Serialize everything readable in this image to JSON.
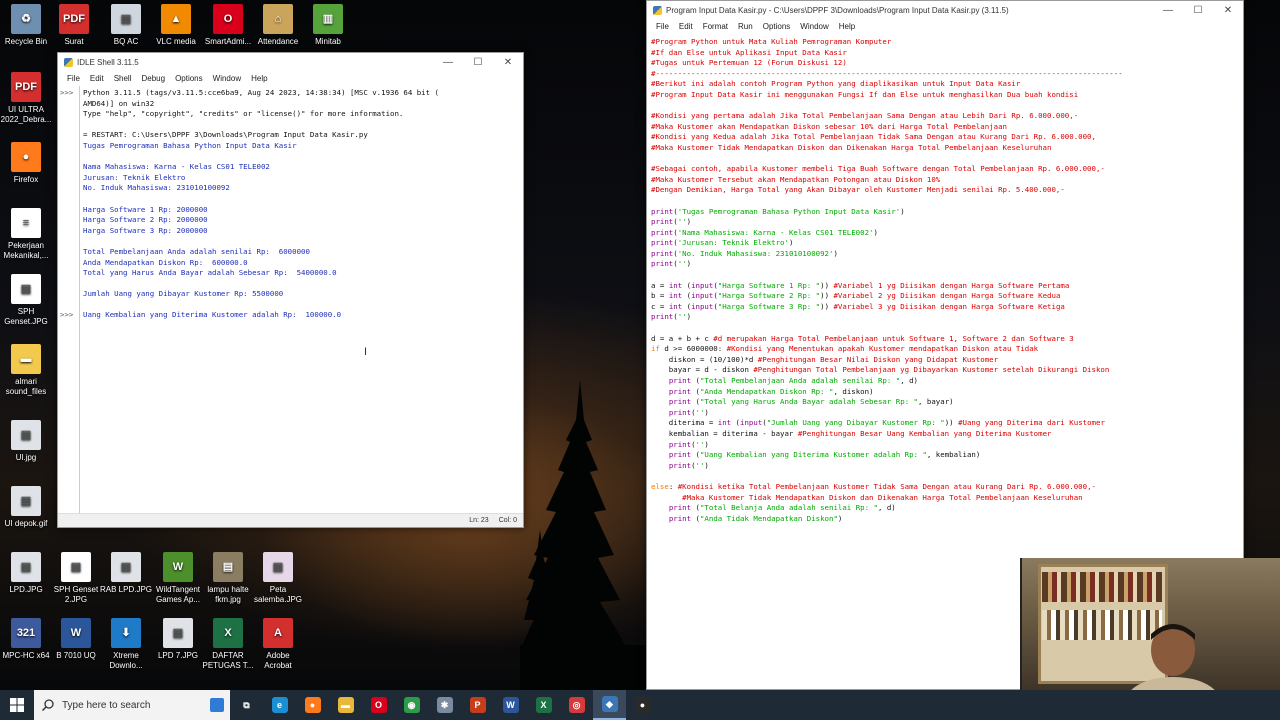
{
  "desktop": {
    "icons": [
      {
        "label": "Recycle Bin",
        "icon": "recycle-bin-icon",
        "color": "#6f8fb0",
        "glyph": "♻"
      },
      {
        "label": "Surat",
        "icon": "pdf-icon",
        "color": "#d32f2f",
        "glyph": "PDF"
      },
      {
        "label": "BQ AC",
        "icon": "image-file-icon",
        "color": "#cfd6dd",
        "glyph": "▤"
      },
      {
        "label": "VLC media",
        "icon": "vlc-icon",
        "color": "#f08a00",
        "glyph": "▲"
      },
      {
        "label": "SmartAdmi...",
        "icon": "opera-icon",
        "color": "#d9001b",
        "glyph": "O"
      },
      {
        "label": "Attendance",
        "icon": "attendance-app-icon",
        "color": "#c9a45a",
        "glyph": "⌂"
      },
      {
        "label": "Minitab",
        "icon": "minitab-icon",
        "color": "#56a33c",
        "glyph": "▥"
      },
      {
        "label": "UI ULTRA 2022_Debra...",
        "icon": "pdf-icon",
        "color": "#d32f2f",
        "glyph": "PDF"
      },
      {
        "label": "Firefox",
        "icon": "firefox-icon",
        "color": "#ff7a1a",
        "glyph": "●"
      },
      {
        "label": "Pekerjaan Mekanikal,...",
        "icon": "document-icon",
        "color": "#ffffff",
        "glyph": "≡"
      },
      {
        "label": "SPH Genset.JPG",
        "icon": "image-file-icon",
        "color": "#ffffff",
        "glyph": "▤"
      },
      {
        "label": "almari sound_files",
        "icon": "folder-icon",
        "color": "#f2c94c",
        "glyph": "▬"
      },
      {
        "label": "Ul.jpg",
        "icon": "image-file-icon",
        "color": "#dfe3e8",
        "glyph": "▤"
      },
      {
        "label": "UI depok.gif",
        "icon": "image-file-icon",
        "color": "#dfe3e8",
        "glyph": "▤"
      },
      {
        "label": "LPD.JPG",
        "icon": "image-file-icon",
        "color": "#dfe3e8",
        "glyph": "▤"
      },
      {
        "label": "SPH Genset 2.JPG",
        "icon": "image-file-icon",
        "color": "#ffffff",
        "glyph": "▤"
      },
      {
        "label": "RAB LPD.JPG",
        "icon": "image-file-icon",
        "color": "#dfe3e8",
        "glyph": "▤"
      },
      {
        "label": "WildTangent Games Ap...",
        "icon": "wildtangent-icon",
        "color": "#4d8f2a",
        "glyph": "W"
      },
      {
        "label": "lampu halte fkm.jpg",
        "icon": "image-file-icon",
        "color": "#8a7d62",
        "glyph": "▤"
      },
      {
        "label": "Peta salemba.JPG",
        "icon": "image-file-icon",
        "color": "#e6d7e9",
        "glyph": "▤"
      },
      {
        "label": "MPC-HC x64",
        "icon": "mpc-hc-icon",
        "color": "#3d5a9c",
        "glyph": "321"
      },
      {
        "label": "B 7010 UQ",
        "icon": "word-icon",
        "color": "#2b579a",
        "glyph": "W"
      },
      {
        "label": "Xtreme Downlo...",
        "icon": "xtreme-download-icon",
        "color": "#1f7ac8",
        "glyph": "⬇"
      },
      {
        "label": "LPD 7.JPG",
        "icon": "image-file-icon",
        "color": "#dfe3e8",
        "glyph": "▤"
      },
      {
        "label": "DAFTAR PETUGAS T...",
        "icon": "excel-icon",
        "color": "#1e7145",
        "glyph": "X"
      },
      {
        "label": "Adobe Acrobat",
        "icon": "acrobat-icon",
        "color": "#d32f2f",
        "glyph": "A"
      }
    ]
  },
  "shell": {
    "title": "IDLE Shell 3.11.5",
    "menu": [
      "File",
      "Edit",
      "Shell",
      "Debug",
      "Options",
      "Window",
      "Help"
    ],
    "gutter": [
      ">>>",
      "",
      "",
      "",
      "",
      "",
      "",
      "",
      "",
      "",
      "",
      "",
      "",
      "",
      "",
      "",
      "",
      "",
      "",
      "",
      "",
      ">>>"
    ],
    "lines": [
      {
        "text": "Python 3.11.5 (tags/v3.11.5:cce6ba9, Aug 24 2023, 14:38:34) [MSC v.1936 64 bit (",
        "cls": "c-black"
      },
      {
        "text": "AMD64)] on win32",
        "cls": "c-black"
      },
      {
        "text": "Type \"help\", \"copyright\", \"credits\" or \"license()\" for more information.",
        "cls": "c-black"
      },
      {
        "text": "",
        "cls": "c-black"
      },
      {
        "text": "= RESTART: C:\\Users\\DPPF 3\\Downloads\\Program Input Data Kasir.py",
        "cls": "c-black"
      },
      {
        "text": "Tugas Pemrograman Bahasa Python Input Data Kasir",
        "cls": "c-blue"
      },
      {
        "text": "",
        "cls": "c-blue"
      },
      {
        "text": "Nama Mahasiswa: Karna - Kelas CS01 TELE002",
        "cls": "c-blue"
      },
      {
        "text": "Jurusan: Teknik Elektro",
        "cls": "c-blue"
      },
      {
        "text": "No. Induk Mahasiswa: 231010100092",
        "cls": "c-blue"
      },
      {
        "text": "",
        "cls": "c-blue"
      },
      {
        "text": "Harga Software 1 Rp: 2000000",
        "cls": "c-blue"
      },
      {
        "text": "Harga Software 2 Rp: 2000000",
        "cls": "c-blue"
      },
      {
        "text": "Harga Software 3 Rp: 2000000",
        "cls": "c-blue"
      },
      {
        "text": "",
        "cls": "c-blue"
      },
      {
        "text": "Total Pembelanjaan Anda adalah senilai Rp:  6000000",
        "cls": "c-blue"
      },
      {
        "text": "Anda Mendapatkan Diskon Rp:  600000.0",
        "cls": "c-blue"
      },
      {
        "text": "Total yang Harus Anda Bayar adalah Sebesar Rp:  5400000.0",
        "cls": "c-blue"
      },
      {
        "text": "",
        "cls": "c-blue"
      },
      {
        "text": "Jumlah Uang yang Dibayar Kustomer Rp: 5500000",
        "cls": "c-blue"
      },
      {
        "text": "",
        "cls": "c-blue"
      },
      {
        "text": "Uang Kembalian yang Diterima Kustomer adalah Rp:  100000.0",
        "cls": "c-blue"
      }
    ],
    "status": {
      "line": "Ln: 23",
      "col": "Col: 0"
    }
  },
  "editor": {
    "title": "Program Input Data Kasir.py - C:\\Users\\DPPF 3\\Downloads\\Program Input Data Kasir.py (3.11.5)",
    "menu": [
      "File",
      "Edit",
      "Format",
      "Run",
      "Options",
      "Window",
      "Help"
    ],
    "lines": [
      [
        {
          "t": "#Program Python untuk Mata Kuliah Pemrograman Komputer",
          "c": "cm"
        }
      ],
      [
        {
          "t": "#If dan Else untuk Aplikasi Input Data Kasir",
          "c": "cm"
        }
      ],
      [
        {
          "t": "#Tugas untuk Pertemuan 12 (Forum Diskusi 12)",
          "c": "cm"
        }
      ],
      [
        {
          "t": "#---------------------------------------------------------------------------------------------------------",
          "c": "cm"
        }
      ],
      [
        {
          "t": "#Berikut ini adalah contoh Program Python yang diaplikasikan untuk Input Data Kasir",
          "c": "cm"
        }
      ],
      [
        {
          "t": "#Program Input Data Kasir ini menggunakan Fungsi If dan Else untuk menghasilkan Dua buah kondisi",
          "c": "cm"
        }
      ],
      [
        {
          "t": "",
          "c": "tx"
        }
      ],
      [
        {
          "t": "#Kondisi yang pertama adalah Jika Total Pembelanjaan Sama Dengan atau Lebih Dari Rp. 6.000.000,-",
          "c": "cm"
        }
      ],
      [
        {
          "t": "#Maka Kustomer akan Mendapatkan Diskon sebesar 10% dari Harga Total Pembelanjaan",
          "c": "cm"
        }
      ],
      [
        {
          "t": "#Kondisi yang Kedua adalah Jika Total Pembelanjaan Tidak Sama Dengan atau Kurang Dari Rp. 6.000.000,",
          "c": "cm"
        }
      ],
      [
        {
          "t": "#Maka Kustomer Tidak Mendapatkan Diskon dan Dikenakan Harga Total Pembelanjaan Keseluruhan",
          "c": "cm"
        }
      ],
      [
        {
          "t": "",
          "c": "tx"
        }
      ],
      [
        {
          "t": "#Sebagai contoh, apabila Kustomer membeli Tiga Buah Software dengan Total Pembelanjaan Rp. 6.000.000,-",
          "c": "cm"
        }
      ],
      [
        {
          "t": "#Maka Kustomer Tersebut akan Mendapatkan Potongan atau Diskon 10%",
          "c": "cm"
        }
      ],
      [
        {
          "t": "#Dengan Demikian, Harga Total yang Akan Dibayar oleh Kustomer Menjadi senilai Rp. 5.400.000,-",
          "c": "cm"
        }
      ],
      [
        {
          "t": "",
          "c": "tx"
        }
      ],
      [
        {
          "t": "print",
          "c": "bi"
        },
        {
          "t": "(",
          "c": "tx"
        },
        {
          "t": "'Tugas Pemrograman Bahasa Python Input Data Kasir'",
          "c": "st"
        },
        {
          "t": ")",
          "c": "tx"
        }
      ],
      [
        {
          "t": "print",
          "c": "bi"
        },
        {
          "t": "(",
          "c": "tx"
        },
        {
          "t": "''",
          "c": "st"
        },
        {
          "t": ")",
          "c": "tx"
        }
      ],
      [
        {
          "t": "print",
          "c": "bi"
        },
        {
          "t": "(",
          "c": "tx"
        },
        {
          "t": "'Nama Mahasiswa: Karna - Kelas CS01 TELE002'",
          "c": "st"
        },
        {
          "t": ")",
          "c": "tx"
        }
      ],
      [
        {
          "t": "print",
          "c": "bi"
        },
        {
          "t": "(",
          "c": "tx"
        },
        {
          "t": "'Jurusan: Teknik Elektro'",
          "c": "st"
        },
        {
          "t": ")",
          "c": "tx"
        }
      ],
      [
        {
          "t": "print",
          "c": "bi"
        },
        {
          "t": "(",
          "c": "tx"
        },
        {
          "t": "'No. Induk Mahasiswa: 231010100092'",
          "c": "st"
        },
        {
          "t": ")",
          "c": "tx"
        }
      ],
      [
        {
          "t": "print",
          "c": "bi"
        },
        {
          "t": "(",
          "c": "tx"
        },
        {
          "t": "''",
          "c": "st"
        },
        {
          "t": ")",
          "c": "tx"
        }
      ],
      [
        {
          "t": "",
          "c": "tx"
        }
      ],
      [
        {
          "t": "a = ",
          "c": "tx"
        },
        {
          "t": "int",
          "c": "bi"
        },
        {
          "t": " (",
          "c": "tx"
        },
        {
          "t": "input",
          "c": "bi"
        },
        {
          "t": "(",
          "c": "tx"
        },
        {
          "t": "\"Harga Software 1 Rp: \"",
          "c": "st"
        },
        {
          "t": ")) ",
          "c": "tx"
        },
        {
          "t": "#Variabel 1 yg Diisikan dengan Harga Software Pertama",
          "c": "cm"
        }
      ],
      [
        {
          "t": "b = ",
          "c": "tx"
        },
        {
          "t": "int",
          "c": "bi"
        },
        {
          "t": " (",
          "c": "tx"
        },
        {
          "t": "input",
          "c": "bi"
        },
        {
          "t": "(",
          "c": "tx"
        },
        {
          "t": "\"Harga Software 2 Rp: \"",
          "c": "st"
        },
        {
          "t": ")) ",
          "c": "tx"
        },
        {
          "t": "#Variabel 2 yg Diisikan dengan Harga Software Kedua",
          "c": "cm"
        }
      ],
      [
        {
          "t": "c = ",
          "c": "tx"
        },
        {
          "t": "int",
          "c": "bi"
        },
        {
          "t": " (",
          "c": "tx"
        },
        {
          "t": "input",
          "c": "bi"
        },
        {
          "t": "(",
          "c": "tx"
        },
        {
          "t": "\"Harga Software 3 Rp: \"",
          "c": "st"
        },
        {
          "t": ")) ",
          "c": "tx"
        },
        {
          "t": "#Variabel 3 yg Diisikan dengan Harga Software Ketiga",
          "c": "cm"
        }
      ],
      [
        {
          "t": "print",
          "c": "bi"
        },
        {
          "t": "(",
          "c": "tx"
        },
        {
          "t": "''",
          "c": "st"
        },
        {
          "t": ")",
          "c": "tx"
        }
      ],
      [
        {
          "t": "",
          "c": "tx"
        }
      ],
      [
        {
          "t": "d = a + b + c ",
          "c": "tx"
        },
        {
          "t": "#d merupakan Harga Total Pembelanjaan untuk Software 1, Software 2 dan Software 3",
          "c": "cm"
        }
      ],
      [
        {
          "t": "if",
          "c": "kw"
        },
        {
          "t": " d >= 6000000: ",
          "c": "tx"
        },
        {
          "t": "#Kondisi yang Menentukan apakah Kustomer mendapatkan Diskon atau Tidak",
          "c": "cm"
        }
      ],
      [
        {
          "t": "    diskon = (10/100)*d ",
          "c": "tx"
        },
        {
          "t": "#Penghitungan Besar Nilai Diskon yang Didapat Kustomer",
          "c": "cm"
        }
      ],
      [
        {
          "t": "    bayar = d - diskon ",
          "c": "tx"
        },
        {
          "t": "#Penghitungan Total Pembelanjaan yg Dibayarkan Kustomer setelah Dikurangi Diskon",
          "c": "cm"
        }
      ],
      [
        {
          "t": "    ",
          "c": "tx"
        },
        {
          "t": "print",
          "c": "bi"
        },
        {
          "t": " (",
          "c": "tx"
        },
        {
          "t": "\"Total Pembelanjaan Anda adalah senilai Rp: \"",
          "c": "st"
        },
        {
          "t": ", d)",
          "c": "tx"
        }
      ],
      [
        {
          "t": "    ",
          "c": "tx"
        },
        {
          "t": "print",
          "c": "bi"
        },
        {
          "t": " (",
          "c": "tx"
        },
        {
          "t": "\"Anda Mendapatkan Diskon Rp: \"",
          "c": "st"
        },
        {
          "t": ", diskon)",
          "c": "tx"
        }
      ],
      [
        {
          "t": "    ",
          "c": "tx"
        },
        {
          "t": "print",
          "c": "bi"
        },
        {
          "t": " (",
          "c": "tx"
        },
        {
          "t": "\"Total yang Harus Anda Bayar adalah Sebesar Rp: \"",
          "c": "st"
        },
        {
          "t": ", bayar)",
          "c": "tx"
        }
      ],
      [
        {
          "t": "    ",
          "c": "tx"
        },
        {
          "t": "print",
          "c": "bi"
        },
        {
          "t": "(",
          "c": "tx"
        },
        {
          "t": "''",
          "c": "st"
        },
        {
          "t": ")",
          "c": "tx"
        }
      ],
      [
        {
          "t": "    diterima = ",
          "c": "tx"
        },
        {
          "t": "int",
          "c": "bi"
        },
        {
          "t": " (",
          "c": "tx"
        },
        {
          "t": "input",
          "c": "bi"
        },
        {
          "t": "(",
          "c": "tx"
        },
        {
          "t": "\"Jumlah Uang yang Dibayar Kustomer Rp: \"",
          "c": "st"
        },
        {
          "t": ")) ",
          "c": "tx"
        },
        {
          "t": "#Uang yang Diterima dari Kustomer",
          "c": "cm"
        }
      ],
      [
        {
          "t": "    kembalian = diterima - bayar ",
          "c": "tx"
        },
        {
          "t": "#Penghitungan Besar Uang Kembalian yang Diterima Kustomer",
          "c": "cm"
        }
      ],
      [
        {
          "t": "    ",
          "c": "tx"
        },
        {
          "t": "print",
          "c": "bi"
        },
        {
          "t": "(",
          "c": "tx"
        },
        {
          "t": "''",
          "c": "st"
        },
        {
          "t": ")",
          "c": "tx"
        }
      ],
      [
        {
          "t": "    ",
          "c": "tx"
        },
        {
          "t": "print",
          "c": "bi"
        },
        {
          "t": " (",
          "c": "tx"
        },
        {
          "t": "\"Uang Kembalian yang Diterima Kustomer adalah Rp: \"",
          "c": "st"
        },
        {
          "t": ", kembalian)",
          "c": "tx"
        }
      ],
      [
        {
          "t": "    ",
          "c": "tx"
        },
        {
          "t": "print",
          "c": "bi"
        },
        {
          "t": "(",
          "c": "tx"
        },
        {
          "t": "''",
          "c": "st"
        },
        {
          "t": ")",
          "c": "tx"
        }
      ],
      [
        {
          "t": "",
          "c": "tx"
        }
      ],
      [
        {
          "t": "else",
          "c": "kw"
        },
        {
          "t": ": ",
          "c": "tx"
        },
        {
          "t": "#Kondisi ketika Total Pembelanjaan Kustomer Tidak Sama Dengan atau Kurang Dari Rp. 6.000.000,-",
          "c": "cm"
        }
      ],
      [
        {
          "t": "       ",
          "c": "tx"
        },
        {
          "t": "#Maka Kustomer Tidak Mendapatkan Diskon dan Dikenakan Harga Total Pembelanjaan Keseluruhan",
          "c": "cm"
        }
      ],
      [
        {
          "t": "    ",
          "c": "tx"
        },
        {
          "t": "print",
          "c": "bi"
        },
        {
          "t": " (",
          "c": "tx"
        },
        {
          "t": "\"Total Belanja Anda adalah senilai Rp: \"",
          "c": "st"
        },
        {
          "t": ", d)",
          "c": "tx"
        }
      ],
      [
        {
          "t": "    ",
          "c": "tx"
        },
        {
          "t": "print",
          "c": "bi"
        },
        {
          "t": " (",
          "c": "tx"
        },
        {
          "t": "\"Anda Tidak Mendapatkan Diskon\"",
          "c": "st"
        },
        {
          "t": ")",
          "c": "tx"
        }
      ]
    ]
  },
  "taskbar": {
    "search_placeholder": "Type here to search",
    "apps": [
      {
        "name": "task-view-icon",
        "glyph": "⧉",
        "color": "#1e2a36"
      },
      {
        "name": "edge-icon",
        "glyph": "e",
        "color": "#1b8fd1"
      },
      {
        "name": "firefox-icon",
        "glyph": "●",
        "color": "#ff7a1a"
      },
      {
        "name": "file-explorer-icon",
        "glyph": "▬",
        "color": "#e9b73a"
      },
      {
        "name": "opera-icon",
        "glyph": "O",
        "color": "#d9001b"
      },
      {
        "name": "chrome-icon",
        "glyph": "◉",
        "color": "#2c9c4a"
      },
      {
        "name": "network-app-icon",
        "glyph": "✱",
        "color": "#7a8aa0"
      },
      {
        "name": "powerpoint-icon",
        "glyph": "P",
        "color": "#c43e1c"
      },
      {
        "name": "word-icon",
        "glyph": "W",
        "color": "#2b579a"
      },
      {
        "name": "excel-icon",
        "glyph": "X",
        "color": "#1e7145"
      },
      {
        "name": "media-app-icon",
        "glyph": "◎",
        "color": "#d63a3a"
      },
      {
        "name": "python-idle-icon",
        "glyph": "◆",
        "color": "#3b77b6"
      },
      {
        "name": "obs-icon",
        "glyph": "●",
        "color": "#2a2a2a"
      }
    ]
  }
}
